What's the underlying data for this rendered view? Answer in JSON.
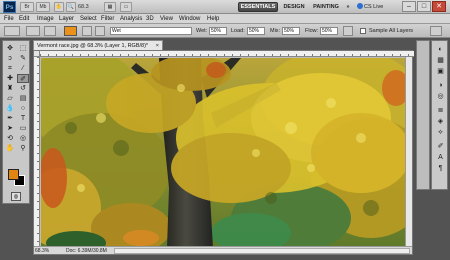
{
  "appbar": {
    "logo": "Ps",
    "zoom": "68.3",
    "workspaces": [
      "ESSENTIALS",
      "DESIGN",
      "PAINTING"
    ],
    "more": "»",
    "cs_live": "CS Live",
    "window_controls": [
      "–",
      "□",
      "✕"
    ]
  },
  "menu": [
    "File",
    "Edit",
    "Image",
    "Layer",
    "Select",
    "Filter",
    "Analysis",
    "3D",
    "View",
    "Window",
    "Help"
  ],
  "options": {
    "mode_value": "Wet",
    "wet_label": "Wet:",
    "wet_value": "50%",
    "load_label": "Load:",
    "load_value": "50%",
    "mix_label": "Mix:",
    "mix_value": "50%",
    "flow_label": "Flow:",
    "flow_value": "50%",
    "sample_all_layers": "Sample All Layers",
    "swatch_color": "#e9911a"
  },
  "document": {
    "tab_title": "Vermont race.jpg @ 68.3% (Layer 1, RGB/8)*",
    "close": "×",
    "status_zoom": "68.3%",
    "status_doc": "Doc: 6.39M/30.8M"
  },
  "colors": {
    "foreground": "#e08412",
    "background": "#000000"
  },
  "icons": {
    "tools": [
      "move-icon",
      "marquee-icon",
      "lasso-icon",
      "quick-select-icon",
      "crop-icon",
      "eyedropper-icon",
      "healing-brush-icon",
      "mixer-brush-icon",
      "clone-stamp-icon",
      "history-brush-icon",
      "eraser-icon",
      "gradient-icon",
      "blur-icon",
      "dodge-icon",
      "pen-icon",
      "type-icon",
      "path-select-icon",
      "shape-icon",
      "3d-rotate-icon",
      "3d-camera-icon",
      "hand-icon",
      "zoom-icon"
    ],
    "dock": [
      "color-panel-icon",
      "swatches-icon",
      "styles-icon",
      "adjustments-icon",
      "masks-icon",
      "layers-icon",
      "channels-icon",
      "paths-icon",
      "brush-presets-icon",
      "character-icon",
      "paragraph-icon"
    ]
  }
}
